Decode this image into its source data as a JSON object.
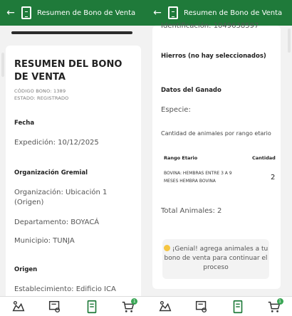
{
  "header": {
    "title": "Resumen de Bono de Venta"
  },
  "left": {
    "title": "RESUMEN DEL BONO DE VENTA",
    "codigo": "CÓDIGO BONO: 1389",
    "estado": "ESTADO: REGISTRADO",
    "fecha_h": "Fecha",
    "expedicion": "Expedición: 10/12/2025",
    "org_h": "Organización Gremial",
    "organizacion": "Organización: Ubicación 1 (Origen)",
    "departamento": "Departamento: BOYACÁ",
    "municipio": "Municipio: TUNJA",
    "origen_h": "Origen",
    "establecimiento": "Establecimiento: Edificio ICA"
  },
  "right": {
    "identificacion": "Identificación: 1049638597",
    "hierros": "Hierros (no hay seleccionados)",
    "ganado_h": "Datos del Ganado",
    "especie": "Especie:",
    "cantidad_h": "Cantidad de animales por rango etario",
    "table": {
      "col1": "Rango Etario",
      "col2": "Cantidad",
      "row1_c1": "BOVINA: HEMBRAS ENTRE 3 A 9 MESES HEMBRA BOVINA",
      "row1_c2": "2"
    },
    "total": "Total Animales: 2",
    "info": "¡Genial! agrega animales a tu bono de venta para continuar el proceso"
  },
  "nav": {
    "cart_badge": "1"
  },
  "colors": {
    "primary": "#1f7a3a",
    "badge": "#3aa655"
  }
}
